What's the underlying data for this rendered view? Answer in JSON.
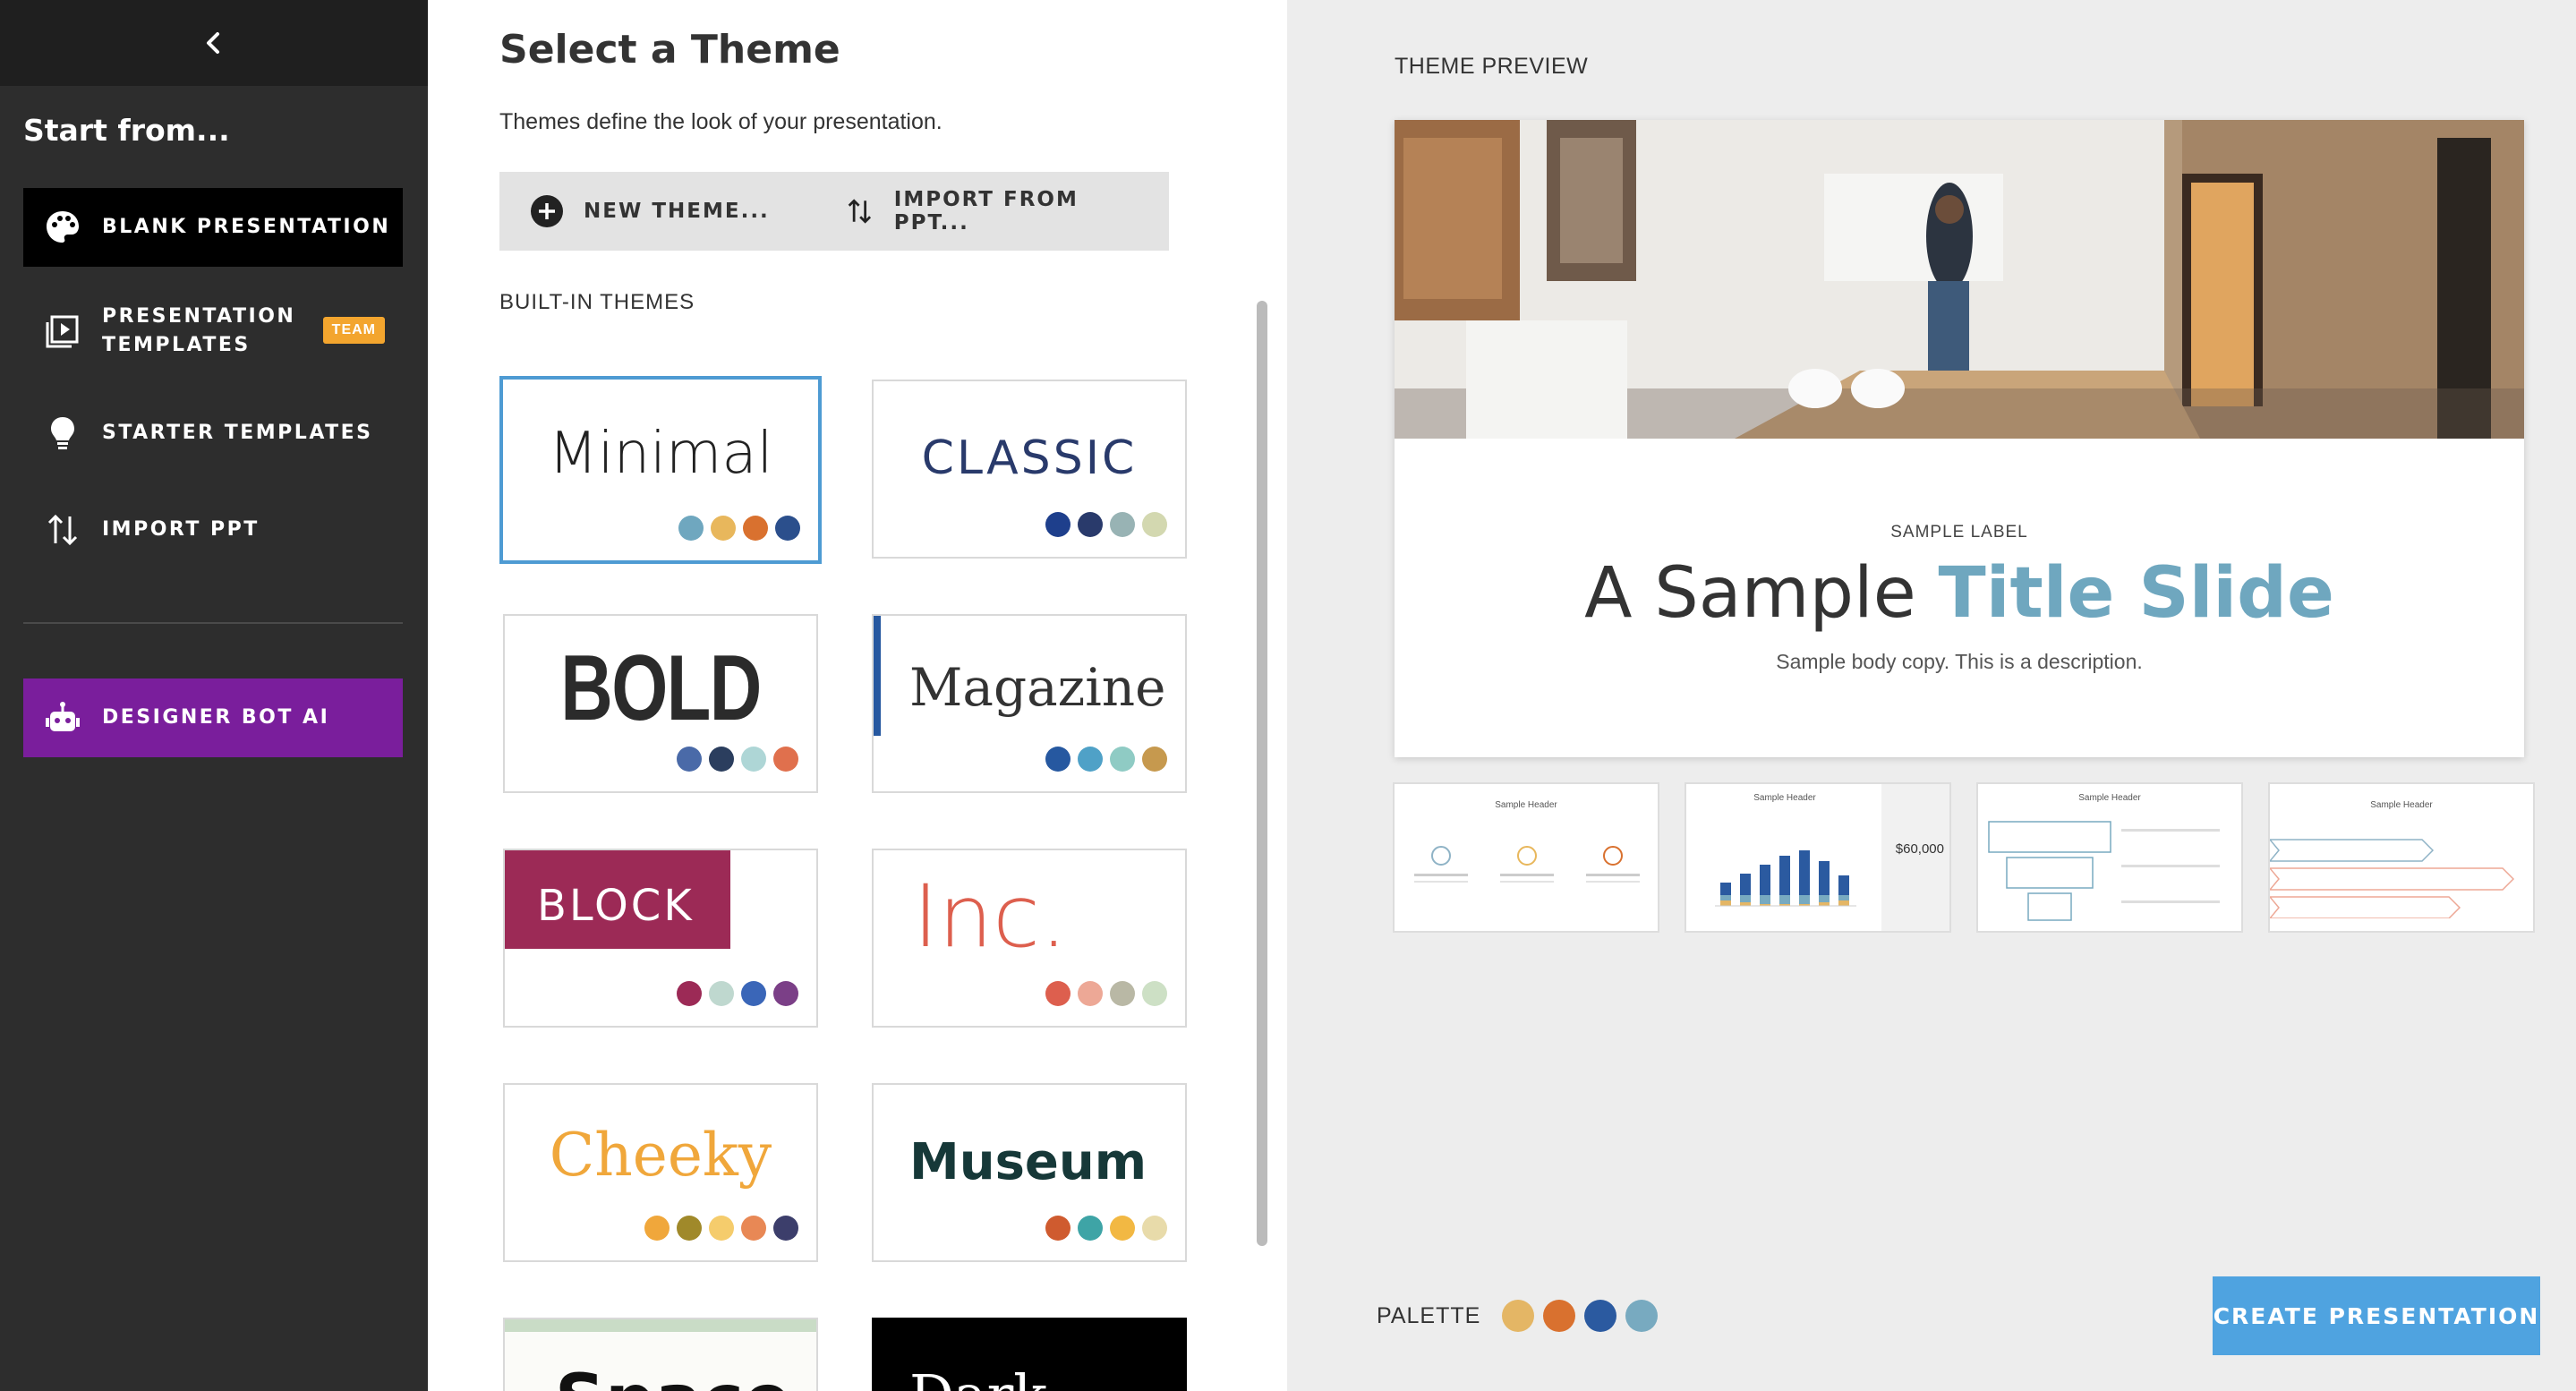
{
  "sidebar": {
    "heading": "Start from...",
    "items": [
      {
        "label": "BLANK PRESENTATION"
      },
      {
        "label": "PRESENTATION TEMPLATES",
        "badge": "TEAM"
      },
      {
        "label": "STARTER TEMPLATES"
      },
      {
        "label": "IMPORT PPT"
      },
      {
        "label": "DESIGNER BOT AI"
      }
    ]
  },
  "main": {
    "title": "Select a Theme",
    "subtitle": "Themes define the look of your presentation.",
    "new_theme_label": "NEW THEME...",
    "import_label": "IMPORT FROM PPT...",
    "section_label": "BUILT-IN THEMES",
    "themes": [
      {
        "name": "Minimal",
        "colors": [
          "#6fa7bf",
          "#e8b75c",
          "#d9712f",
          "#2b4f8c"
        ]
      },
      {
        "name": "CLASSIC",
        "colors": [
          "#1e3f8c",
          "#293a6b",
          "#98b3b4",
          "#d3d8b0"
        ]
      },
      {
        "name": "BOLD",
        "colors": [
          "#4a6aa8",
          "#2b3e5e",
          "#aed6d6",
          "#e0704d"
        ]
      },
      {
        "name": "Magazine",
        "colors": [
          "#2658a0",
          "#4fa1c7",
          "#8fcbc4",
          "#c6994e"
        ]
      },
      {
        "name": "BLOCK",
        "colors": [
          "#9c2a56",
          "#bfd8cf",
          "#3a66b8",
          "#7b3f87"
        ]
      },
      {
        "name": "Inc.",
        "colors": [
          "#dd5f4e",
          "#eda896",
          "#b9b8a5",
          "#cde0c5"
        ]
      },
      {
        "name": "Cheeky",
        "colors": [
          "#f0a73b",
          "#a0892a",
          "#f5cc6c",
          "#e88855",
          "#3c3e6b"
        ]
      },
      {
        "name": "Museum",
        "colors": [
          "#cf5b2f",
          "#3ea4a6",
          "#f2b843",
          "#e8dbaa"
        ]
      },
      {
        "name": "Space",
        "colors": []
      },
      {
        "name": "Dark",
        "colors": []
      }
    ]
  },
  "preview": {
    "label": "THEME PREVIEW",
    "slide_label": "SAMPLE LABEL",
    "slide_title_a": "A Sample ",
    "slide_title_b": "Title Slide",
    "slide_body": "Sample body copy. This is a description.",
    "thumbs": [
      {
        "header": "Sample Header"
      },
      {
        "header": "Sample Header",
        "value": "$60,000"
      },
      {
        "header": "Sample Header"
      },
      {
        "header": "Sample Header"
      }
    ],
    "palette_label": "PALETTE",
    "palette": [
      "#e4b665",
      "#d9712f",
      "#2b5aa0",
      "#78aac0"
    ],
    "create_label": "CREATE PRESENTATION"
  }
}
